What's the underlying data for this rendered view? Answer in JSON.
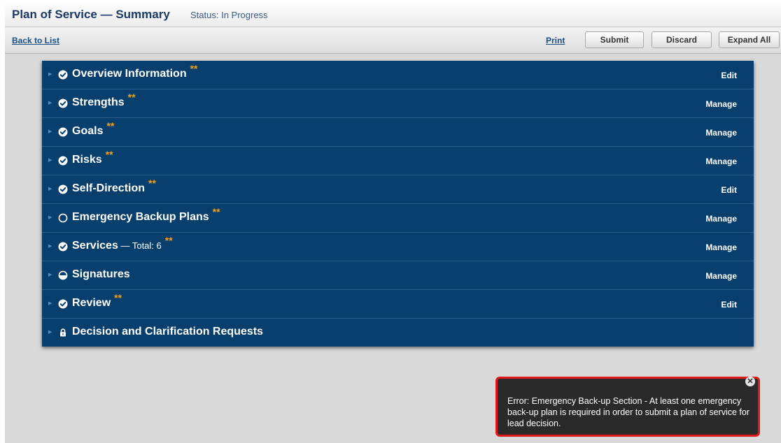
{
  "header": {
    "title": "Plan of Service — Summary",
    "status": "Status: In Progress"
  },
  "toolbar": {
    "back": "Back to List",
    "print": "Print",
    "submit": "Submit",
    "discard": "Discard",
    "expand_all": "Expand All"
  },
  "sections": [
    {
      "label": "Overview Information",
      "sub": "",
      "stars": "**",
      "action": "Edit",
      "status_icon": "check-circle-icon"
    },
    {
      "label": "Strengths",
      "sub": "",
      "stars": "**",
      "action": "Manage",
      "status_icon": "check-circle-icon"
    },
    {
      "label": "Goals",
      "sub": "",
      "stars": "**",
      "action": "Manage",
      "status_icon": "check-circle-icon"
    },
    {
      "label": "Risks",
      "sub": "",
      "stars": "**",
      "action": "Manage",
      "status_icon": "check-circle-icon"
    },
    {
      "label": "Self-Direction",
      "sub": "",
      "stars": "**",
      "action": "Edit",
      "status_icon": "check-circle-icon"
    },
    {
      "label": "Emergency Backup Plans",
      "sub": "",
      "stars": "**",
      "action": "Manage",
      "status_icon": "empty-circle-icon"
    },
    {
      "label": "Services",
      "sub": " — Total: 6",
      "stars": "**",
      "action": "Manage",
      "status_icon": "check-circle-icon"
    },
    {
      "label": "Signatures",
      "sub": "",
      "stars": "",
      "action": "Manage",
      "status_icon": "half-circle-icon"
    },
    {
      "label": "Review",
      "sub": "",
      "stars": "**",
      "action": "Edit",
      "status_icon": "check-circle-icon"
    },
    {
      "label": "Decision and Clarification Requests",
      "sub": "",
      "stars": "",
      "action": "",
      "status_icon": "lock-icon"
    }
  ],
  "error_toast": {
    "message": "Error: Emergency Back-up Section - At least one emergency back-up plan is required in order to submit a plan of service for lead decision.",
    "close": "✕"
  },
  "colors": {
    "panel": "#083f6d",
    "stars": "#f2a115",
    "error_border": "#e01a1a"
  }
}
